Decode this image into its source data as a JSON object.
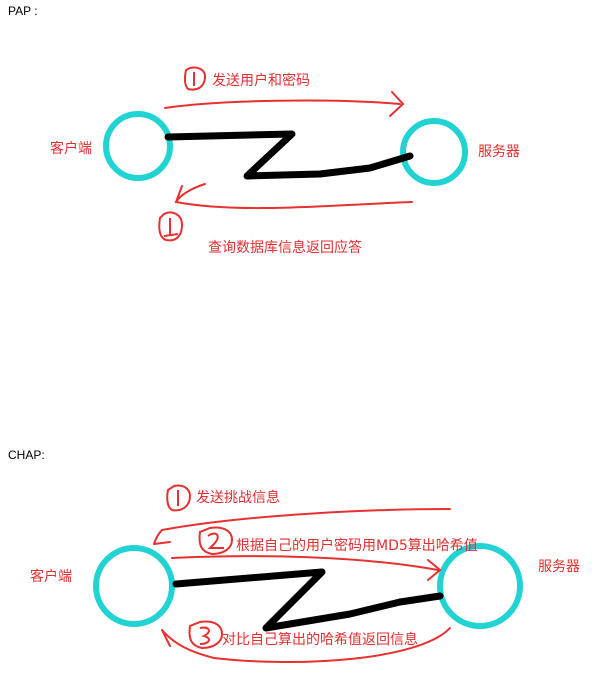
{
  "pap": {
    "header": "PAP :",
    "client": "客户端",
    "server": "服务器",
    "step1": {
      "num": "1",
      "text": "发送用户和密码"
    },
    "step2": {
      "num": "1",
      "text": "查询数据库信息返回应答"
    }
  },
  "chap": {
    "header": "CHAP:",
    "client": "客户端",
    "server": "服务器",
    "step1": {
      "num": "1",
      "text": "发送挑战信息"
    },
    "step2": {
      "num": "2",
      "text": "根据自己的用户密码用MD5算出哈希值"
    },
    "step3": {
      "num": "3",
      "text": "对比自己算出的哈希值返回信息"
    }
  },
  "colors": {
    "node": "#22d3d3",
    "link": "#000000",
    "annotation": "#e83030"
  }
}
